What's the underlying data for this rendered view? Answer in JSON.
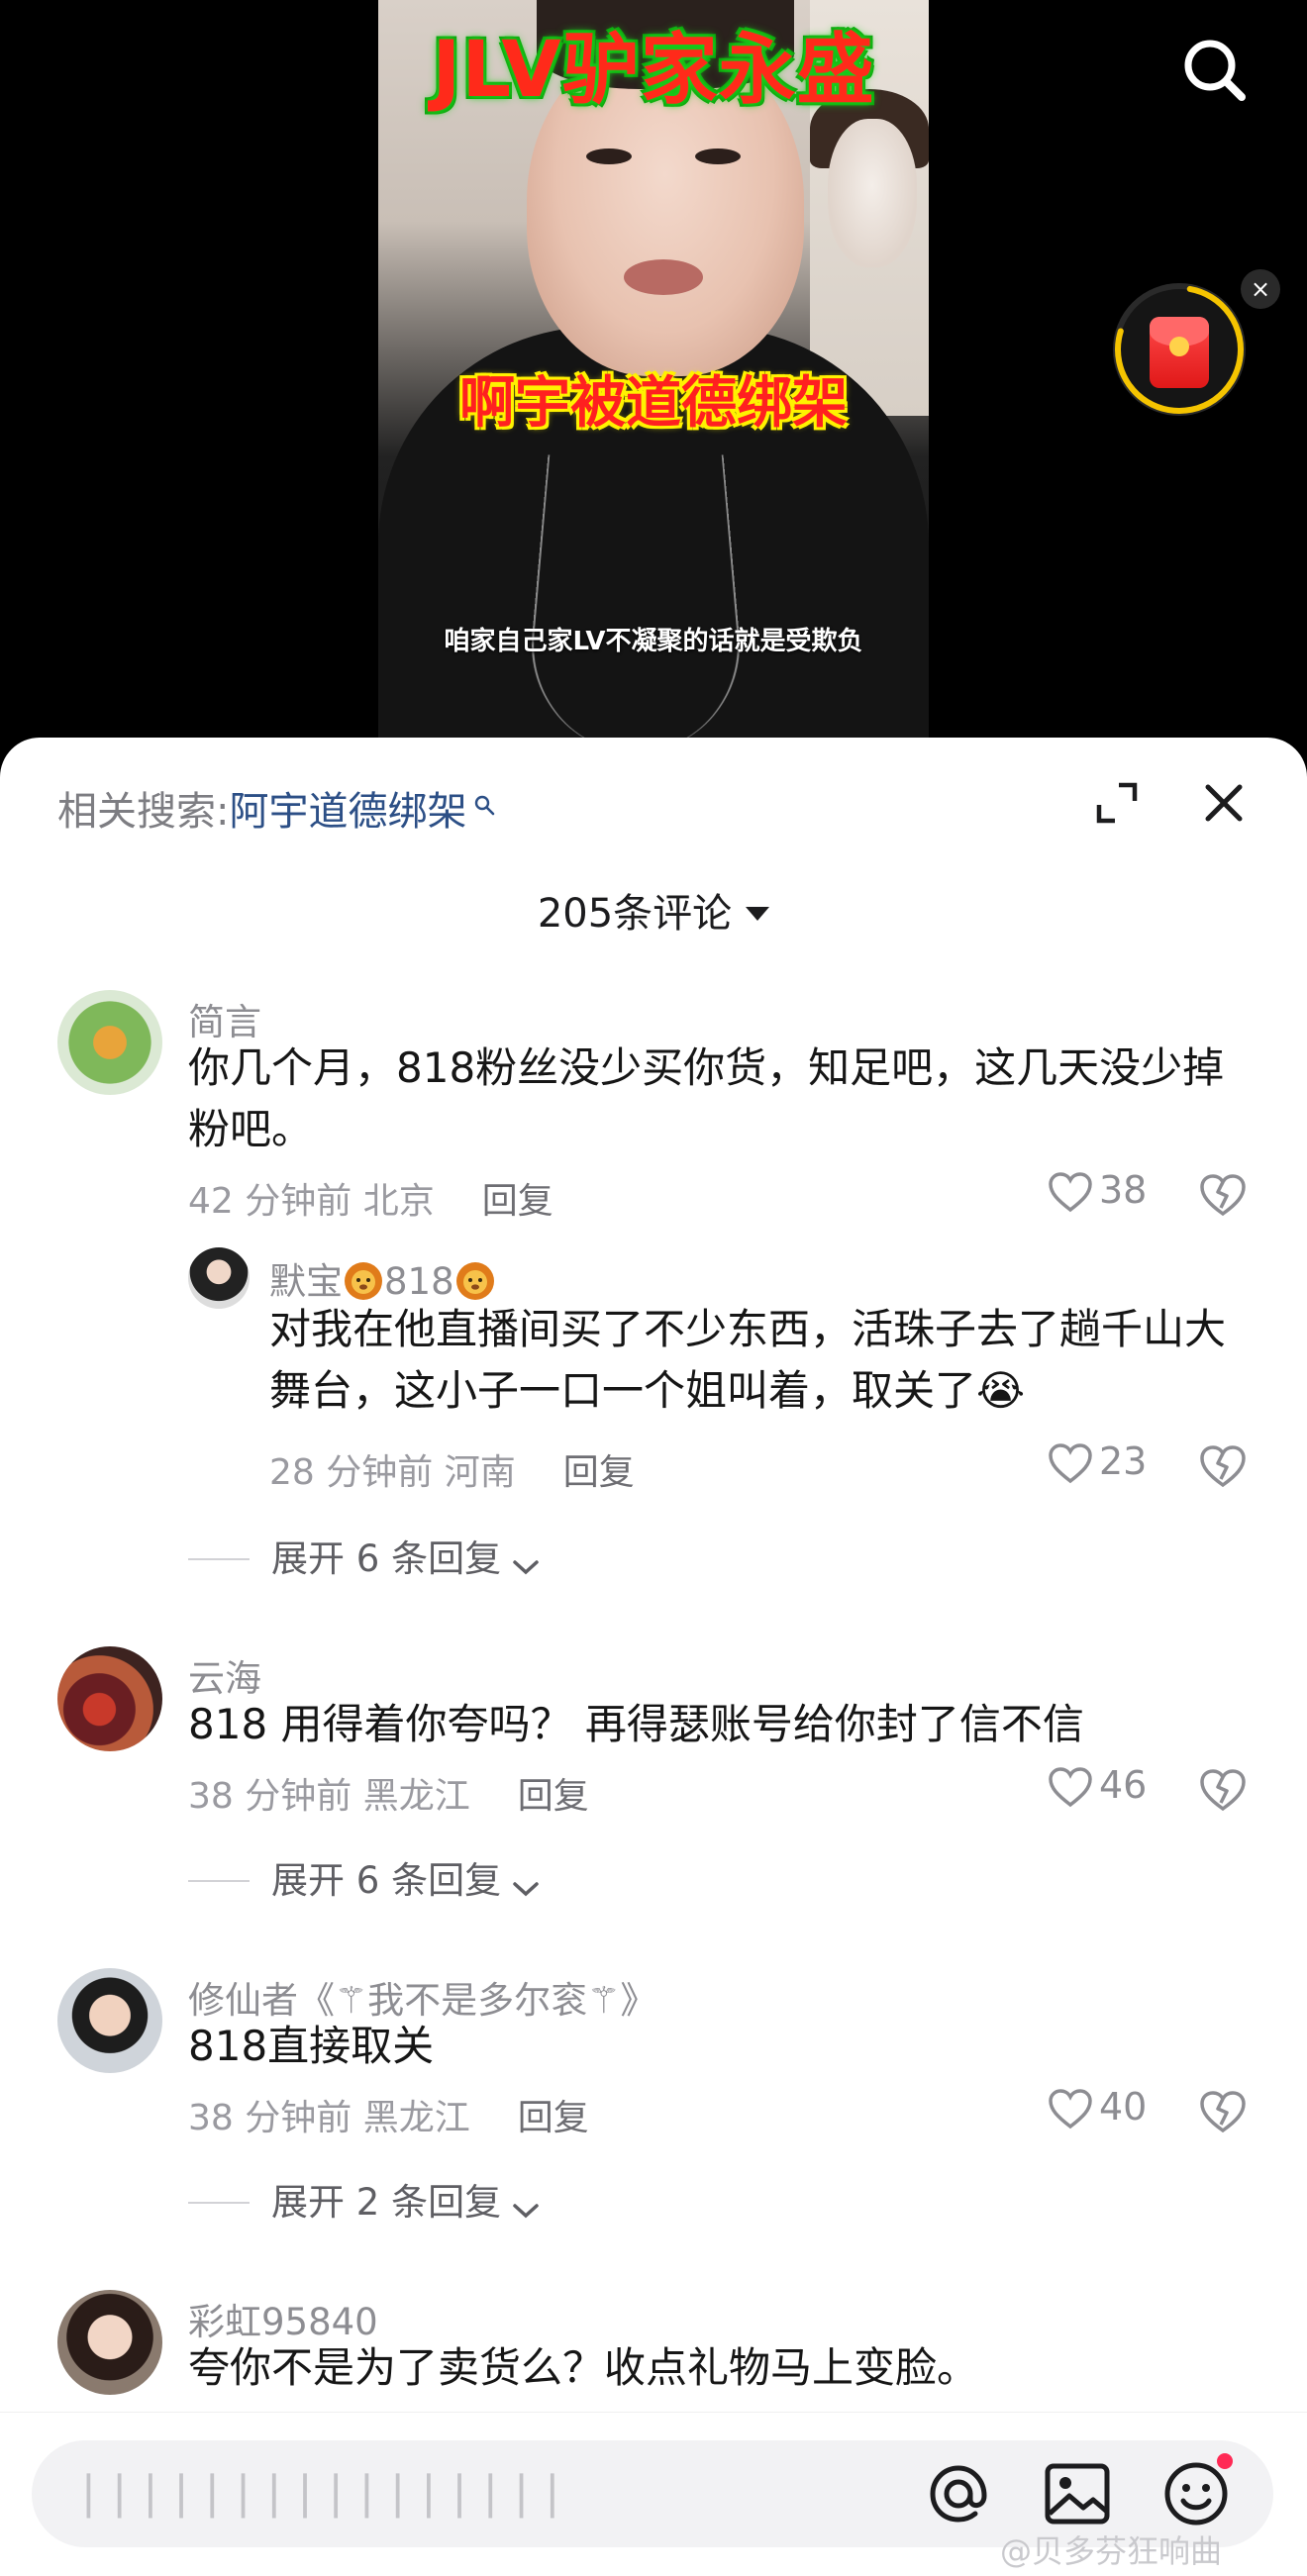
{
  "video": {
    "title": "JLV驴家永盛",
    "overlay": "啊宇被道德绑架",
    "subtitle": "咱家自己家LV不凝聚的话就是受欺负"
  },
  "sheet": {
    "related_label": "相关搜索:",
    "related_keyword": "阿宇道德绑架",
    "comment_count": "205条评论"
  },
  "comments": [
    {
      "user": "简言",
      "text": "你几个月，818粉丝没少买你货，知足吧，这几天没少掉粉吧。",
      "time_loc": "42 分钟前 北京",
      "reply": "回复",
      "likes": "38",
      "sub": {
        "user_prefix": "默宝",
        "user_mid": "818",
        "text": "对我在他直播间买了不少东西，活珠子去了趟千山大舞台，这小子一口一个姐叫着，取关了",
        "text_emoji": "😭",
        "time_loc": "28 分钟前 河南",
        "reply": "回复",
        "likes": "23"
      },
      "expand": "展开 6 条回复"
    },
    {
      "user": "云海",
      "text": "818 用得着你夸吗？ 再得瑟账号给你封了信不信",
      "time_loc": "38 分钟前 黑龙江",
      "reply": "回复",
      "likes": "46",
      "expand": "展开 6 条回复"
    },
    {
      "user": "修仙者《⚚我不是多尔衮⚚》",
      "text": "818直接取关",
      "time_loc": "38 分钟前 黑龙江",
      "reply": "回复",
      "likes": "40",
      "expand": "展开 2 条回复"
    },
    {
      "user": "彩虹95840",
      "text": "夸你不是为了卖货么？收点礼物马上变脸。"
    }
  ],
  "bottom": {
    "placeholder": "▏▏▏▏▏▏▏▏▏▏▏▏▏▏▏▏",
    "watermark": "@贝多芬狂响曲"
  },
  "colors": {
    "accent_link": "#2c4f86",
    "notif": "#ff2a55",
    "redpacket": "#e01818",
    "ring": "#f5c400"
  },
  "icons": [
    "search-icon",
    "red-packet-icon",
    "close-icon",
    "expand-icon",
    "heart-icon",
    "dislike-heart-icon",
    "chevron-down-icon",
    "at-icon",
    "image-icon",
    "emoji-icon"
  ]
}
